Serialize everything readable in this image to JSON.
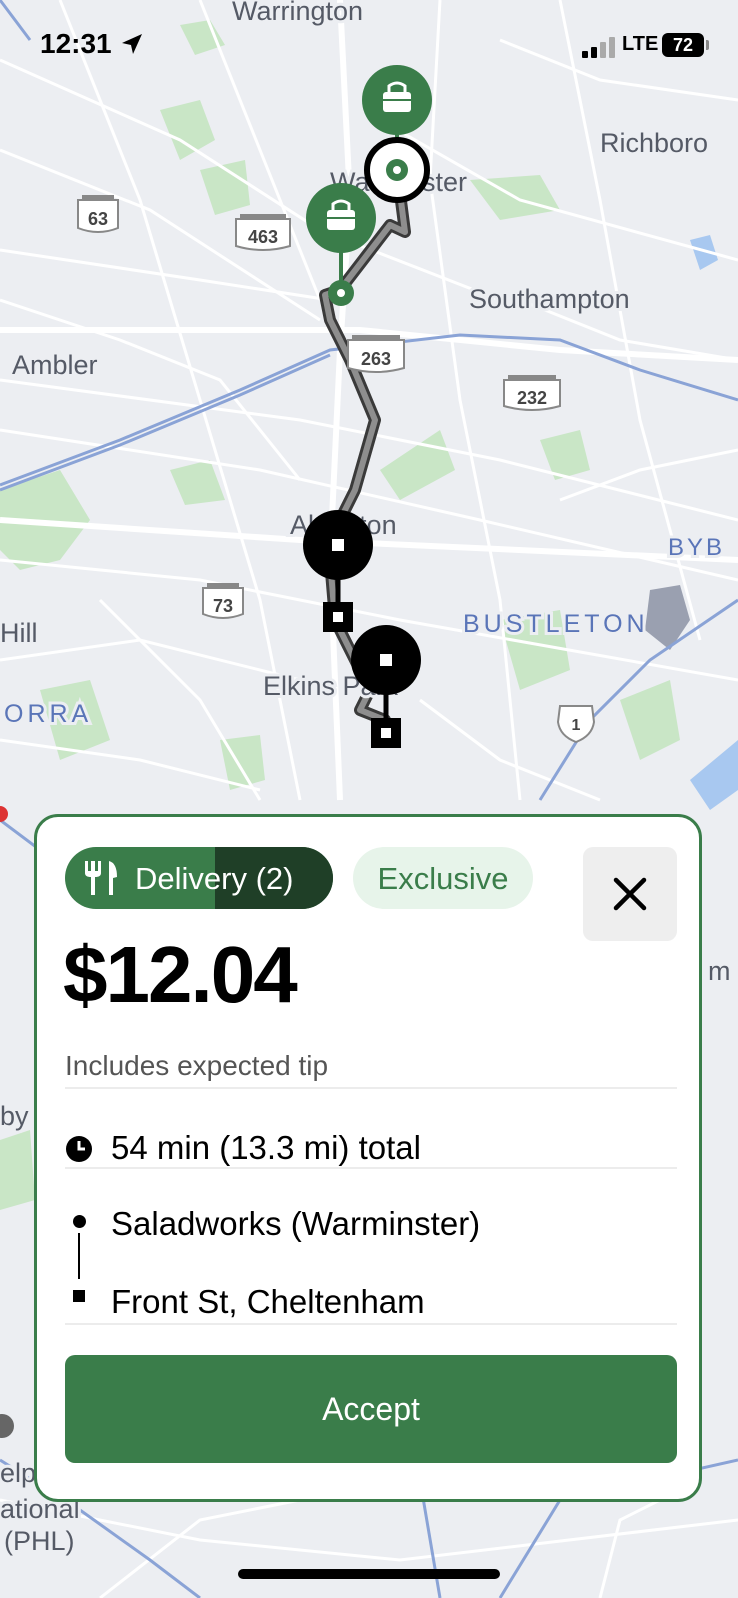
{
  "status_bar": {
    "time": "12:31",
    "network": "LTE",
    "battery": "72"
  },
  "map": {
    "places": [
      "Warrington",
      "Richboro",
      "Warminster",
      "Southampton",
      "Ambler",
      "Abington",
      "BYB",
      "BUSTLETON",
      "Hill",
      "Elkins Park",
      "ORRA",
      "m",
      "by",
      "elp",
      "ational",
      "(PHL)"
    ],
    "route_shields": [
      "63",
      "463",
      "263",
      "232",
      "73",
      "1"
    ]
  },
  "offer": {
    "type_label": "Delivery (2)",
    "exclusive_label": "Exclusive",
    "price": "$12.04",
    "tip_note": "Includes expected tip",
    "duration": "54 min (13.3 mi) total",
    "pickup": "Saladworks (Warminster)",
    "dropoff": "Front St, Cheltenham",
    "accept_label": "Accept"
  },
  "colors": {
    "accent": "#3a7d4a",
    "accent_dark": "#1f3f27",
    "exclusive_bg": "#e7f4ea"
  }
}
